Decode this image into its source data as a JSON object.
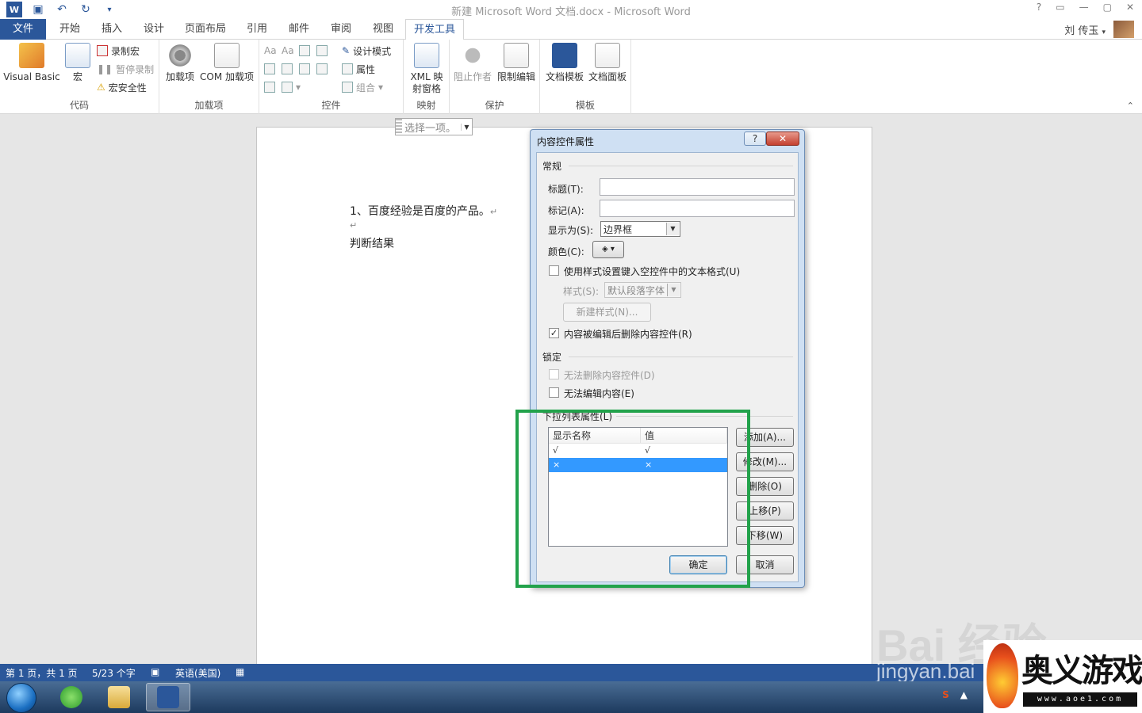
{
  "titlebar": {
    "title": "新建 Microsoft Word 文档.docx - Microsoft Word",
    "controls": [
      "?",
      "▭",
      "—",
      "▢",
      "✕"
    ]
  },
  "tabs": {
    "file": "文件",
    "items": [
      "开始",
      "插入",
      "设计",
      "页面布局",
      "引用",
      "邮件",
      "审阅",
      "视图",
      "开发工具"
    ]
  },
  "user": {
    "name": "刘 传玉",
    "arrow": "▾"
  },
  "ribbon": {
    "code": {
      "label": "代码",
      "visual_basic": "Visual Basic",
      "macros": "宏",
      "record_macro": "录制宏",
      "pause_recording": "暂停录制",
      "macro_security": "宏安全性"
    },
    "addins": {
      "label": "加载项",
      "addins": "加载项",
      "com_addins": "COM 加载项"
    },
    "controls": {
      "label": "控件",
      "design_mode": "设计模式",
      "properties": "属性",
      "group": "组合"
    },
    "mapping": {
      "label": "映射",
      "xml_pane_line1": "XML 映",
      "xml_pane_line2": "射窗格"
    },
    "protect": {
      "label": "保护",
      "block_authors": "阻止作者",
      "restrict_editing": "限制编辑"
    },
    "templates": {
      "label": "模板",
      "document_template": "文档模板",
      "document_panel": "文档面板"
    }
  },
  "document": {
    "line1": "1、百度经验是百度的产品。",
    "para_mark": "↵",
    "line3_prefix": "判断结果",
    "content_control_placeholder": "选择一项。"
  },
  "dialog": {
    "title": "内容控件属性",
    "help": "?",
    "close": "✕",
    "general": {
      "label": "常规",
      "title_label": "标题(T):",
      "title_value": "",
      "tag_label": "标记(A):",
      "tag_value": "",
      "show_as_label": "显示为(S):",
      "show_as_value": "边界框",
      "color_label": "颜色(C):",
      "use_style_label": "使用样式设置键入空控件中的文本格式(U)",
      "use_style_checked": false,
      "style_label": "样式(S):",
      "style_value": "默认段落字体",
      "new_style_button": "新建样式(N)...",
      "remove_on_edit_label": "内容被编辑后删除内容控件(R)",
      "remove_on_edit_checked": true
    },
    "locking": {
      "label": "锁定",
      "cannot_delete_label": "无法删除内容控件(D)",
      "cannot_edit_label": "无法编辑内容(E)"
    },
    "dropdown": {
      "label": "下拉列表属性(L)",
      "columns": [
        "显示名称",
        "值"
      ],
      "rows": [
        {
          "name": "√",
          "value": "√",
          "selected": false
        },
        {
          "name": "×",
          "value": "×",
          "selected": true
        }
      ],
      "add": "添加(A)...",
      "modify": "修改(M)...",
      "remove": "删除(O)",
      "move_up": "上移(P)",
      "move_down": "下移(W)"
    },
    "ok": "确定",
    "cancel": "取消"
  },
  "statusbar": {
    "page": "第 1 页，共 1 页",
    "words": "5/23 个字",
    "language": "英语(美国)"
  },
  "watermark": {
    "brand": "Bai 经验",
    "url": "jingyan.bai"
  },
  "overlay_logo": {
    "name": "奥义游戏网",
    "url": "www.aoe1.com"
  },
  "colors": {
    "accent": "#2b579a",
    "highlight_box": "#22a24b",
    "selection": "#3399ff"
  }
}
